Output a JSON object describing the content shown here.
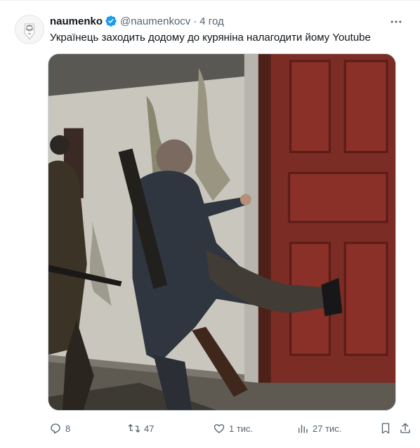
{
  "tweet": {
    "author_name": "naumenko",
    "author_handle": "@naumenkocv",
    "separator": "·",
    "time": "4 год",
    "text": "Українець заходить додому до куряніна налагодити йому Youtube",
    "verified_color": "#1d9bf0"
  },
  "actions": {
    "replies": "8",
    "reposts": "47",
    "likes": "1 тис.",
    "views": "27 тис."
  },
  "icons": {
    "reply": "reply-icon",
    "repost": "repost-icon",
    "like": "heart-icon",
    "views": "views-icon",
    "bookmark": "bookmark-icon",
    "share": "share-icon",
    "more": "more-icon",
    "verified": "verified-badge-icon"
  }
}
